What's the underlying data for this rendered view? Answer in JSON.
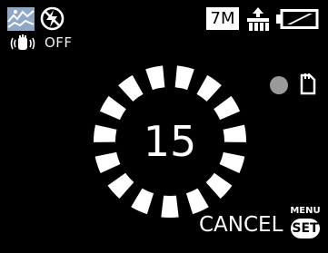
{
  "status_bar": {
    "scene_mode_icon": "scenery-icon",
    "flash_icon": "flash-off-icon",
    "resolution_label": "7M",
    "quality_icon": "fine-quality-icon",
    "battery_icon": "battery-icon"
  },
  "stabilizer": {
    "icon": "optical-image-stabilizer-icon",
    "label": "OFF"
  },
  "recording": {
    "indicator_icon": "record-dot-icon",
    "storage_icon": "memory-card-icon"
  },
  "self_timer": {
    "seconds_remaining": "15",
    "segments_total": 15,
    "ring_icon": "self-timer-ring"
  },
  "footer": {
    "cancel_label": "CANCEL",
    "menu_label": "MENU",
    "set_label": "SET"
  },
  "colors": {
    "background": "#000000",
    "foreground": "#ffffff",
    "indicator_gray": "#9a9a9a",
    "scene_icon_blue": "#8fa8c8"
  }
}
